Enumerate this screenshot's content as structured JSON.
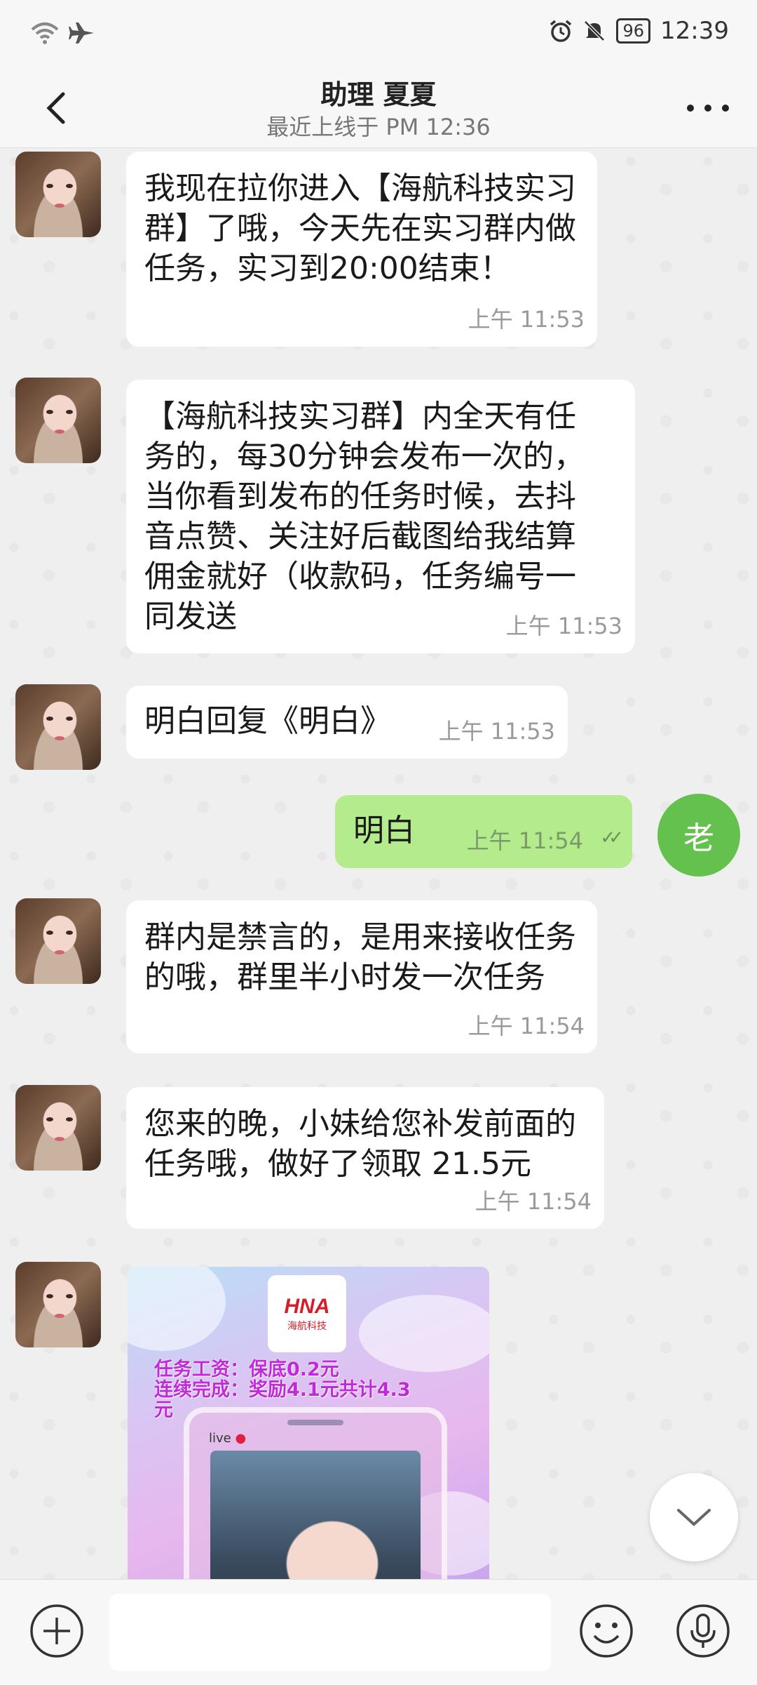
{
  "status_bar": {
    "time": "12:39",
    "battery": "96",
    "icons": [
      "wifi-icon",
      "airplane-icon",
      "alarm-icon",
      "mute-icon",
      "battery-icon"
    ]
  },
  "header": {
    "title": "助理 夏夏",
    "subtitle": "最近上线于 PM 12:36"
  },
  "messages": [
    {
      "sender": "contact",
      "text": "我现在拉你进入【海航科技实习群】了哦，今天先在实习群内做任务，实习到20:00结束！",
      "time": "上午  11:53"
    },
    {
      "sender": "contact",
      "text": "【海航科技实习群】内全天有任务的，每30分钟会发布一次的，当你看到发布的任务时候，去抖音点赞、关注好后截图给我结算佣金就好（收款码，任务编号一同发送",
      "time": "上午  11:53"
    },
    {
      "sender": "contact",
      "text": "明白回复《明白》",
      "time": "上午  11:53"
    },
    {
      "sender": "self",
      "text": "明白",
      "time": "上午  11:54",
      "read": true
    },
    {
      "sender": "contact",
      "text": "群内是禁言的，是用来接收任务的哦，群里半小时发一次任务",
      "time": "上午  11:54"
    },
    {
      "sender": "contact",
      "text": "您来的晚，小妹给您补发前面的任务哦，做好了领取 21.5元",
      "time": "上午  11:54"
    }
  ],
  "self_avatar": "老",
  "image_message": {
    "logo_text": "HNA",
    "logo_subtext": "海航科技",
    "promo_line1": "任务工资：保底0.2元",
    "promo_line2": "连续完成：奖励4.1元共计4.3",
    "promo_line3": "元",
    "live_label": "live"
  },
  "input_bar": {
    "placeholder": ""
  },
  "colors": {
    "self_bubble": "#b4eb8c",
    "self_avatar": "#64c14e",
    "background": "#efefef"
  }
}
